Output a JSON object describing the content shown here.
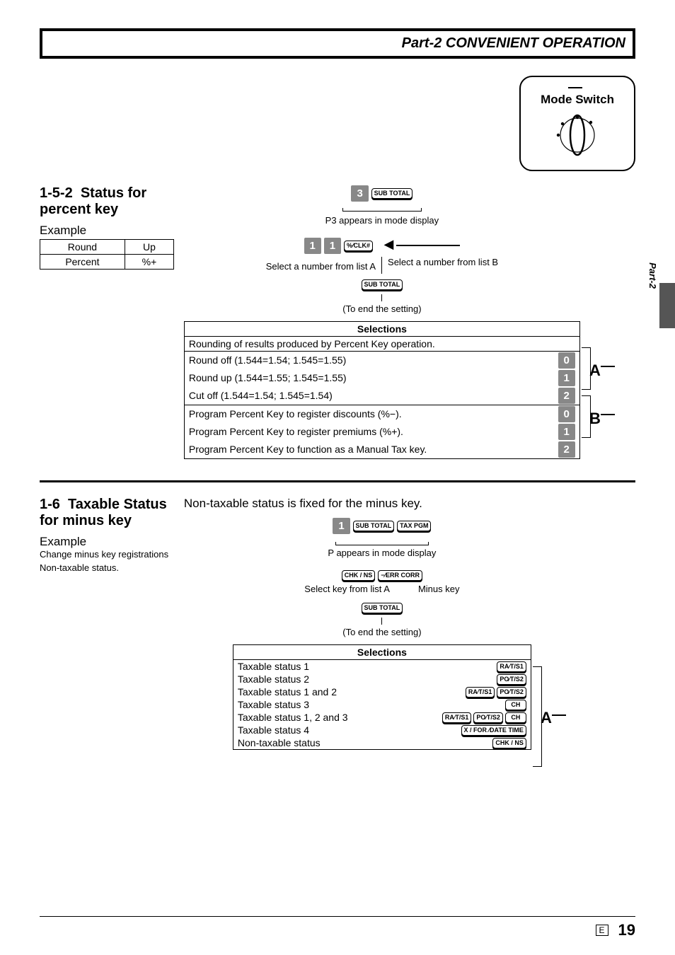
{
  "header": {
    "title": "Part-2 CONVENIENT OPERATION"
  },
  "sidetab": {
    "label": "Part-2"
  },
  "modeSwitch": {
    "label": "Mode Switch"
  },
  "sec152": {
    "number": "1-5-2",
    "title": "Status for percent key",
    "exampleLabel": "Example",
    "exTable": {
      "r1c1": "Round",
      "r1c2": "Up",
      "r2c1": "Percent",
      "r2c2": "%+"
    },
    "step1": {
      "num": "3",
      "key": "SUB TOTAL",
      "note": "P3 appears in mode display"
    },
    "step2": {
      "numA": "1",
      "numB": "1",
      "key": "%⁄CLK#",
      "noteA": "Select a number from  list A",
      "noteB": "Select a number from list B",
      "endKey": "SUB TOTAL",
      "endNote": "(To end the setting)"
    },
    "arrowLeft": "◀",
    "selections": {
      "header": "Selections",
      "groupA_title": "Rounding of results produced by Percent Key operation.",
      "rows": [
        {
          "txt": "Round off (1.544=1.54; 1.545=1.55)",
          "num": "0"
        },
        {
          "txt": "Round up (1.544=1.55; 1.545=1.55)",
          "num": "1"
        },
        {
          "txt": "Cut off (1.544=1.54; 1.545=1.54)",
          "num": "2"
        },
        {
          "txt": "Program Percent Key to register discounts (%−).",
          "num": "0"
        },
        {
          "txt": "Program Percent Key to register premiums (%+).",
          "num": "1"
        },
        {
          "txt": "Program Percent Key to function as a Manual Tax key.",
          "num": "2"
        }
      ],
      "letterA": "A",
      "letterB": "B"
    }
  },
  "sec16": {
    "number": "1-6",
    "title": "Taxable Status for minus key",
    "lead": "Non-taxable status is fixed for the minus key.",
    "exampleLabel": "Example",
    "exampleText1": "Change minus key registrations",
    "exampleText2": "Non-taxable status.",
    "step1": {
      "num": "1",
      "key1": "SUB TOTAL",
      "key2": "TAX PGM",
      "note": "P appears in mode display"
    },
    "step2": {
      "keyA": "CHK / NS",
      "keyB": "−⁄ERR CORR",
      "noteA": "Select key from list A",
      "noteB": "Minus key",
      "endKey": "SUB TOTAL",
      "endNote": "(To end the setting)"
    },
    "selections": {
      "header": "Selections",
      "rows": [
        {
          "txt": "Taxable status 1",
          "keys": [
            "RA⁄T/S1"
          ]
        },
        {
          "txt": "Taxable status 2",
          "keys": [
            "PO⁄T/S2"
          ]
        },
        {
          "txt": "Taxable status 1 and 2",
          "keys": [
            "RA⁄T/S1",
            "PO⁄T/S2"
          ]
        },
        {
          "txt": "Taxable status 3",
          "keys": [
            "CH"
          ]
        },
        {
          "txt": "Taxable status 1, 2 and 3",
          "keys": [
            "RA⁄T/S1",
            "PO⁄T/S2",
            "CH"
          ]
        },
        {
          "txt": "Taxable status 4",
          "keys": [
            "X / FOR ⁄DATE TIME"
          ]
        },
        {
          "txt": "Non-taxable status",
          "keys": [
            "CHK / NS"
          ]
        }
      ],
      "letterA": "A"
    }
  },
  "footer": {
    "e": "E",
    "page": "19"
  }
}
